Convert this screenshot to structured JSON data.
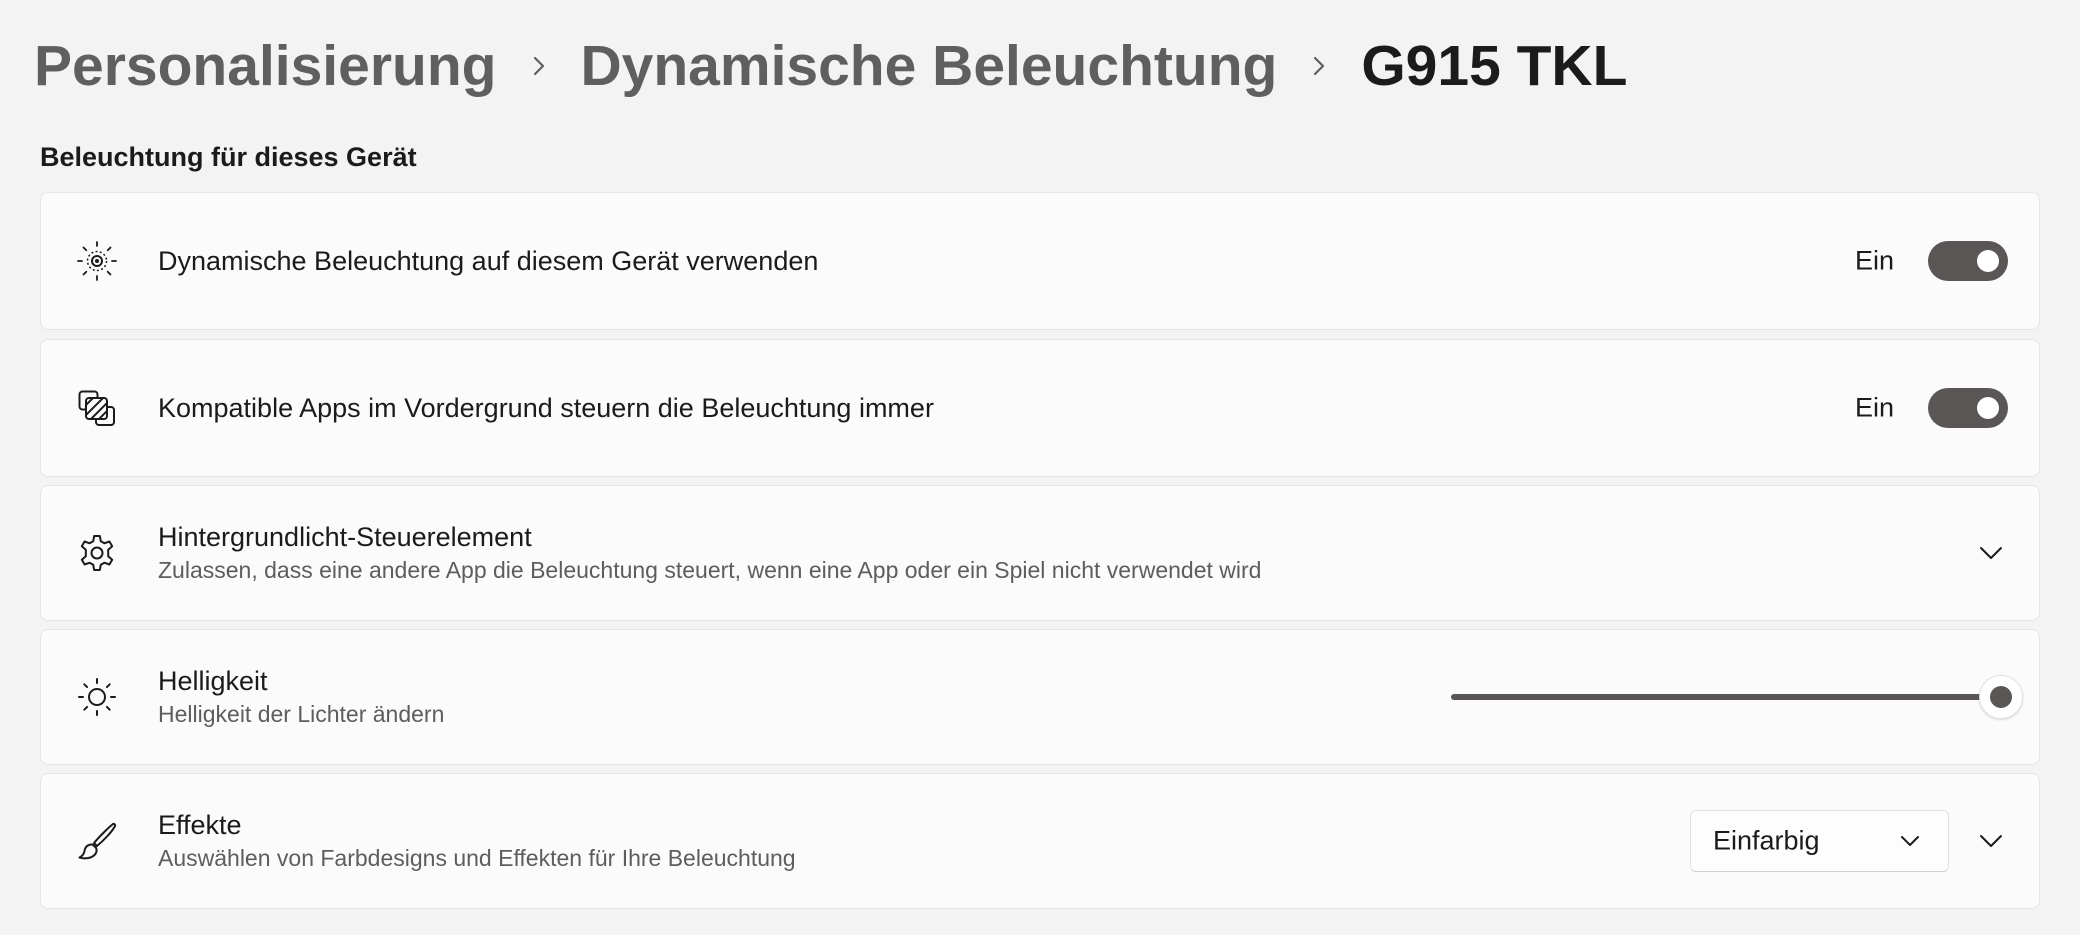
{
  "breadcrumb": {
    "items": [
      "Personalisierung",
      "Dynamische Beleuchtung",
      "G915 TKL"
    ]
  },
  "section": {
    "title": "Beleuchtung für dieses Gerät"
  },
  "cards": {
    "use_dynamic_lighting": {
      "icon": "sun-rays-icon",
      "title": "Dynamische Beleuchtung auf diesem Gerät verwenden",
      "toggle_label": "Ein",
      "toggle_on": true
    },
    "foreground_apps": {
      "icon": "layered-apps-icon",
      "title": "Kompatible Apps im Vordergrund steuern die Beleuchtung immer",
      "toggle_label": "Ein",
      "toggle_on": true
    },
    "background_control": {
      "icon": "gear-icon",
      "title": "Hintergrundlicht-Steuerelement",
      "subtitle": "Zulassen, dass eine andere App die Beleuchtung steuert, wenn eine App oder ein Spiel nicht verwendet wird"
    },
    "brightness": {
      "icon": "brightness-icon",
      "title": "Helligkeit",
      "subtitle": "Helligkeit der Lichter ändern",
      "value_fraction": 1.0
    },
    "effects": {
      "icon": "brush-icon",
      "title": "Effekte",
      "subtitle": "Auswählen von Farbdesigns und Effekten für Ihre Beleuchtung",
      "selected": "Einfarbig"
    }
  },
  "colors": {
    "accent": "#5a5656",
    "background": "#f3f3f3",
    "card": "#fbfbfb"
  }
}
